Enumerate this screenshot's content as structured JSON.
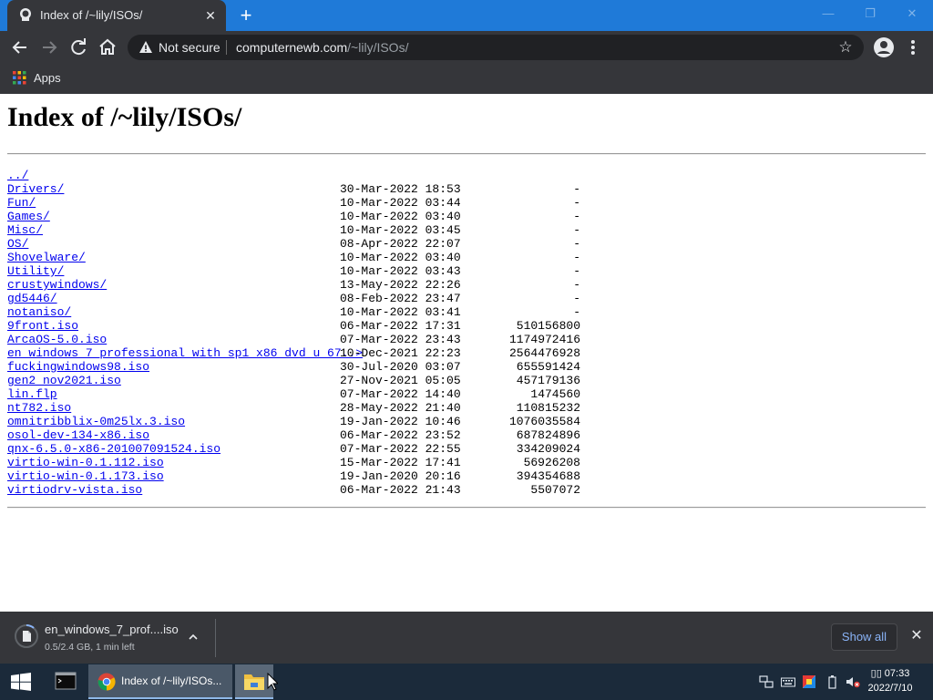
{
  "browser": {
    "tab_title": "Index of /~lily/ISOs/",
    "url_security_label": "Not secure",
    "url_host": "computernewb.com",
    "url_path": "/~lily/ISOs/",
    "bookmarks": [
      {
        "label": "Apps"
      }
    ]
  },
  "page": {
    "heading": "Index of /~lily/ISOs/",
    "listing": [
      {
        "name": "../",
        "date": "",
        "size": ""
      },
      {
        "name": "Drivers/",
        "date": "30-Mar-2022 18:53",
        "size": "-"
      },
      {
        "name": "Fun/",
        "date": "10-Mar-2022 03:44",
        "size": "-"
      },
      {
        "name": "Games/",
        "date": "10-Mar-2022 03:40",
        "size": "-"
      },
      {
        "name": "Misc/",
        "date": "10-Mar-2022 03:45",
        "size": "-"
      },
      {
        "name": "OS/",
        "date": "08-Apr-2022 22:07",
        "size": "-"
      },
      {
        "name": "Shovelware/",
        "date": "10-Mar-2022 03:40",
        "size": "-"
      },
      {
        "name": "Utility/",
        "date": "10-Mar-2022 03:43",
        "size": "-"
      },
      {
        "name": "crustywindows/",
        "date": "13-May-2022 22:26",
        "size": "-"
      },
      {
        "name": "gd5446/",
        "date": "08-Feb-2022 23:47",
        "size": "-"
      },
      {
        "name": "notaniso/",
        "date": "10-Mar-2022 03:41",
        "size": "-"
      },
      {
        "name": "9front.iso",
        "date": "06-Mar-2022 17:31",
        "size": "510156800"
      },
      {
        "name": "ArcaOS-5.0.iso",
        "date": "07-Mar-2022 23:43",
        "size": "1174972416"
      },
      {
        "name": "en_windows_7_professional_with_sp1_x86_dvd_u_67..>",
        "date": "10-Dec-2021 22:23",
        "size": "2564476928"
      },
      {
        "name": "fuckingwindows98.iso",
        "date": "30-Jul-2020 03:07",
        "size": "655591424"
      },
      {
        "name": "gen2_nov2021.iso",
        "date": "27-Nov-2021 05:05",
        "size": "457179136"
      },
      {
        "name": "lin.flp",
        "date": "07-Mar-2022 14:40",
        "size": "1474560"
      },
      {
        "name": "nt782.iso",
        "date": "28-May-2022 21:40",
        "size": "110815232"
      },
      {
        "name": "omnitribblix-0m25lx.3.iso",
        "date": "19-Jan-2022 10:46",
        "size": "1076035584"
      },
      {
        "name": "osol-dev-134-x86.iso",
        "date": "06-Mar-2022 23:52",
        "size": "687824896"
      },
      {
        "name": "qnx-6.5.0-x86-201007091524.iso",
        "date": "07-Mar-2022 22:55",
        "size": "334209024"
      },
      {
        "name": "virtio-win-0.1.112.iso",
        "date": "15-Mar-2022 17:41",
        "size": "56926208"
      },
      {
        "name": "virtio-win-0.1.173.iso",
        "date": "19-Jan-2020 20:16",
        "size": "394354688"
      },
      {
        "name": "virtiodrv-vista.iso",
        "date": "06-Mar-2022 21:43",
        "size": "5507072"
      }
    ]
  },
  "download_shelf": {
    "file_name": "en_windows_7_prof....iso",
    "status": "0.5/2.4 GB, 1 min left",
    "show_all_label": "Show all"
  },
  "taskbar": {
    "chrome_window_label": "Index of /~lily/ISOs...",
    "clock_time": "▯▯ 07:33",
    "clock_date": "2022/7/10"
  },
  "colors": {
    "tabstrip": "#1f7ad8",
    "chrome_dark": "#35363a",
    "link": "#0000ee",
    "show_all_text": "#8ab4f8",
    "taskbar": "#1b2a3a"
  },
  "icons": [
    "page-favicon-icon",
    "close-tab-icon",
    "new-tab-icon",
    "back-icon",
    "forward-icon",
    "reload-icon",
    "home-icon",
    "warning-icon",
    "star-icon",
    "profile-icon",
    "menu-icon",
    "apps-grid-icon",
    "file-download-icon",
    "chevron-up-icon",
    "close-icon",
    "windows-start-icon",
    "terminal-icon",
    "chrome-icon",
    "folder-icon",
    "network-icon",
    "keyboard-icon",
    "color-icon",
    "battery-icon",
    "speaker-muted-icon",
    "mouse-pointer-icon"
  ]
}
